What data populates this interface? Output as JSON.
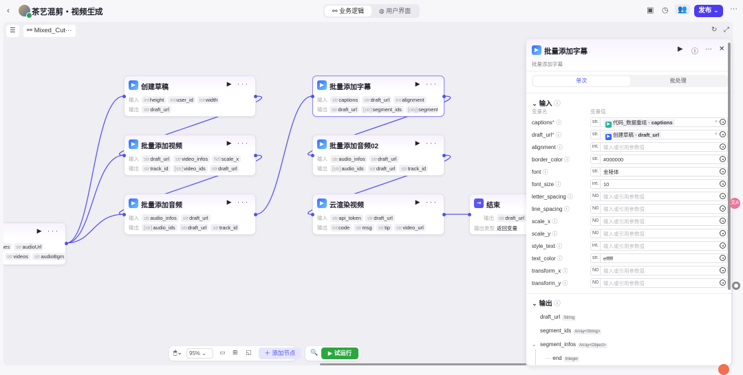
{
  "header": {
    "back_icon": "chevron-left-icon",
    "title": "茶艺混剪・视频生成",
    "tabs": [
      {
        "label": "业务逻辑",
        "active": true
      },
      {
        "label": "用户界面",
        "active": false
      }
    ],
    "publish_label": "发布",
    "accent": "#4d3bf2"
  },
  "canvas": {
    "breadcrumb": "Mixed_Cut···"
  },
  "nodes": [
    {
      "id": "create_draft",
      "title": "创建草稿",
      "inputs": [
        [
          "int",
          "height"
        ],
        [
          "int",
          "user_id"
        ],
        [
          "int",
          "width"
        ]
      ],
      "outputs": [
        [
          "str",
          "draft_url"
        ]
      ]
    },
    {
      "id": "add_videos",
      "title": "批量添加视频",
      "inputs": [
        [
          "str",
          "draft_url"
        ],
        [
          "str",
          "video_infos"
        ],
        [
          "N0",
          "scale_x"
        ]
      ],
      "outputs": [
        [
          "str",
          "track_id"
        ],
        [
          "[str]",
          "video_ids"
        ],
        [
          "str",
          "draft_url"
        ]
      ]
    },
    {
      "id": "add_audios",
      "title": "批量添加音频",
      "inputs": [
        [
          "str",
          "audio_infos"
        ],
        [
          "str",
          "draft_url"
        ]
      ],
      "outputs": [
        [
          "[str]",
          "audio_ids"
        ],
        [
          "str",
          "draft_url"
        ],
        [
          "str",
          "track_id"
        ]
      ]
    },
    {
      "id": "add_captions",
      "title": "批量添加字幕",
      "inputs": [
        [
          "str",
          "captions"
        ],
        [
          "str",
          "draft_url"
        ],
        [
          "int",
          "alignment"
        ]
      ],
      "outputs": [
        [
          "str",
          "draft_url"
        ],
        [
          "[str]",
          "segment_ids"
        ],
        [
          "[obj]",
          "segment"
        ]
      ]
    },
    {
      "id": "add_audios02",
      "title": "批量添加音频02",
      "inputs": [
        [
          "str",
          "audio_infos"
        ],
        [
          "str",
          "draft_url"
        ]
      ],
      "outputs": [
        [
          "[str]",
          "audio_ids"
        ],
        [
          "str",
          "draft_url"
        ],
        [
          "str",
          "track_id"
        ]
      ]
    },
    {
      "id": "cloud_render",
      "title": "云渲染视频",
      "inputs": [
        [
          "str",
          "api_token"
        ],
        [
          "str",
          "draft_url"
        ]
      ],
      "outputs": [
        [
          "int",
          "code"
        ],
        [
          "str",
          "msg"
        ],
        [
          "str",
          "tip"
        ],
        [
          "str",
          "video_url"
        ]
      ]
    }
  ],
  "labels": {
    "input": "输入",
    "output": "输出",
    "output_type": "输出类型"
  },
  "start_node": {
    "row1": [
      [
        "",
        "nes"
      ],
      [
        "str",
        "audioUrl"
      ]
    ],
    "row2": [
      [
        "str",
        "videos"
      ],
      [
        "str",
        "audioBgm"
      ]
    ]
  },
  "end_node": {
    "title": "结束",
    "output": [
      "str",
      "draft_url"
    ],
    "output_type": "返回变量"
  },
  "panel": {
    "title": "批量添加字幕",
    "subtitle": "批量添加字幕",
    "tabs": [
      "单次",
      "批处理"
    ],
    "input_header": "输入",
    "col_name": "变量名",
    "col_value": "变量值",
    "placeholder": "输入或引用参数值",
    "params": [
      {
        "name": "captions",
        "required": true,
        "type": "str.",
        "ref_node": "代码_数据重组",
        "ref_var": "captions",
        "ref_color": "#2bb3a0"
      },
      {
        "name": "draft_url",
        "required": true,
        "type": "str.",
        "ref_node": "创建草稿",
        "ref_var": "draft_url",
        "ref_color": "#2f6bff"
      },
      {
        "name": "alignment",
        "type": "int.",
        "value": ""
      },
      {
        "name": "border_color",
        "type": "str.",
        "value": "#000000"
      },
      {
        "name": "font",
        "type": "str.",
        "value": "金陵体"
      },
      {
        "name": "font_size",
        "type": "int.",
        "value": "10"
      },
      {
        "name": "letter_spacing",
        "type": "N0",
        "value": ""
      },
      {
        "name": "line_spacing",
        "type": "N0",
        "value": ""
      },
      {
        "name": "scale_x",
        "type": "N0",
        "value": ""
      },
      {
        "name": "scale_y",
        "type": "N0",
        "value": ""
      },
      {
        "name": "style_text",
        "type": "int.",
        "value": ""
      },
      {
        "name": "text_color",
        "type": "str.",
        "value": "efffff"
      },
      {
        "name": "transform_x",
        "type": "N0",
        "value": ""
      },
      {
        "name": "transform_y",
        "type": "N0",
        "value": ""
      }
    ],
    "output_header": "输出",
    "outputs": [
      {
        "name": "draft_url",
        "type": "String"
      },
      {
        "name": "segment_ids",
        "type": "Array<String>"
      },
      {
        "name": "segment_infos",
        "type": "Array<Object>"
      },
      {
        "name": "end",
        "type": "Integer"
      }
    ]
  },
  "toolbar": {
    "zoom": "95%",
    "add_node": "添加节点",
    "test_run": "试运行",
    "test_color": "#2ba640"
  }
}
